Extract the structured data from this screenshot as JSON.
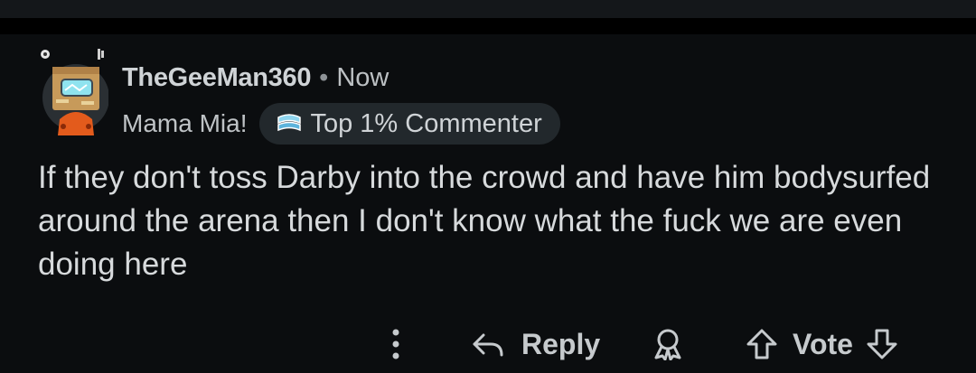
{
  "comment": {
    "username": "TheGeeMan360",
    "separator": "•",
    "timestamp": "Now",
    "flair_text": "Mama Mia!",
    "badge_label": "Top 1% Commenter",
    "body": "If they don't toss Darby into the crowd and have him bodysurfed around the arena then I don't know what the fuck we are even doing here"
  },
  "actions": {
    "reply_label": "Reply",
    "vote_label": "Vote"
  },
  "icons": {
    "more": "more-vertical-icon",
    "reply": "reply-arrow-icon",
    "award": "award-icon",
    "upvote": "upvote-arrow-icon",
    "downvote": "downvote-arrow-icon",
    "badge": "top-commenter-badge-icon"
  },
  "colors": {
    "background": "#0b0d0f",
    "text": "#d7dadc",
    "badge_background": "#22282c",
    "avatar_shirt": "#e35b1c"
  }
}
